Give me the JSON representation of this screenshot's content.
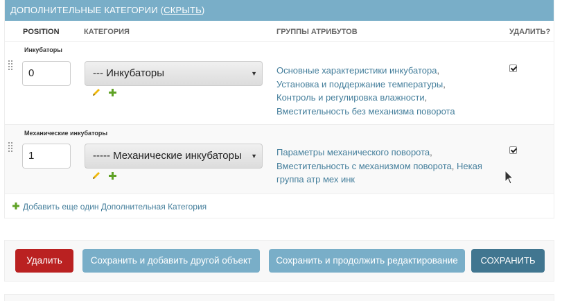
{
  "inline_group": {
    "header_text": "ДОПОЛНИТЕЛЬНЫЕ КАТЕГОРИИ (",
    "hide_link": "СКРЫТЬ",
    "header_close": ")",
    "columns": {
      "position": "POSITION",
      "category": "КАТЕГОРИЯ",
      "attribute_groups": "ГРУППЫ АТРИБУТОВ",
      "delete": "УДАЛИТЬ?"
    },
    "rows": [
      {
        "title": "Инкубаторы",
        "position_value": "0",
        "category_selected": "--- Инкубаторы",
        "groups": [
          {
            "label": "Основные характеристики инкубатора",
            "sep": ","
          },
          {
            "label": "Установка и поддержание температуры",
            "sep": ","
          },
          {
            "label": "Контроль и регулировка влажности",
            "sep": ","
          },
          {
            "label": "Вместительность без механизма поворота",
            "sep": ""
          }
        ],
        "delete_checked": true
      },
      {
        "title": "Механические инкубаторы",
        "position_value": "1",
        "category_selected": "----- Механические инкубаторы",
        "groups": [
          {
            "label": "Параметры механического поворота",
            "sep": ","
          },
          {
            "label": "Вместительность с механизмом поворота",
            "sep": ","
          },
          {
            "label": "Некая группа атр мех инк",
            "sep": ""
          }
        ],
        "delete_checked": true
      }
    ],
    "add_another_label": "Добавить еще один Дополнительная Категория"
  },
  "submit_row": {
    "delete_label": "Удалить",
    "save_add_another_label": "Сохранить и добавить другой объект",
    "save_continue_label": "Сохранить и продолжить редактирование",
    "save_label": "СОХРАНИТЬ"
  },
  "icons": {
    "edit": "pencil-icon",
    "add": "plus-icon",
    "drag": "drag-handle-icon",
    "select_arrow": "caret-down-icon"
  },
  "colors": {
    "header_bg": "#79aec8",
    "link": "#447e9b",
    "delete_button": "#ba2121",
    "primary_button": "#417690",
    "secondary_button": "#79aec8",
    "add_green": "#5fa225",
    "edit_yellow": "#efb80b"
  }
}
